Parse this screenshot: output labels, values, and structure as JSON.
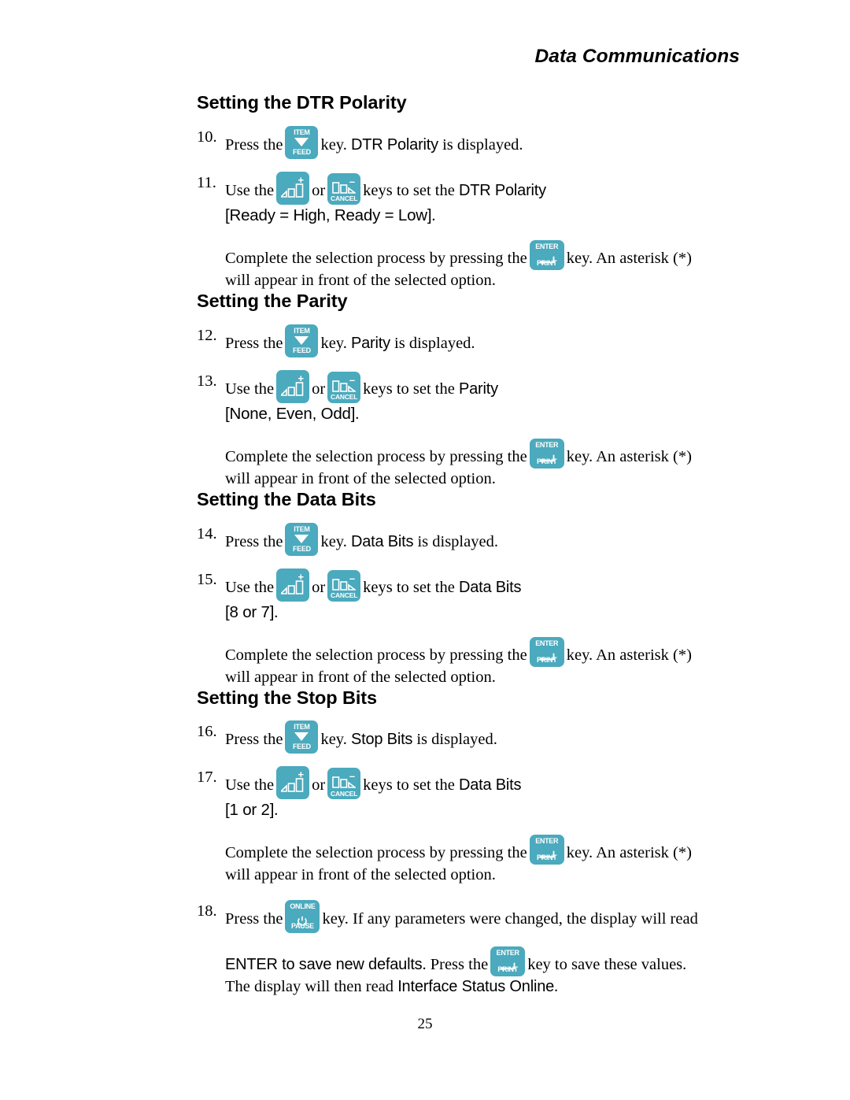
{
  "header": {
    "running_title": "Data Communications"
  },
  "footer": {
    "page_number": "25"
  },
  "keys": {
    "item_feed": {
      "top_label": "ITEM",
      "bottom_label": "FEED",
      "glyph": "triangle-down-icon"
    },
    "plus": {
      "sign": "+",
      "glyph": "bars-ascending-icon"
    },
    "cancel": {
      "sign": "–",
      "bottom_label": "CANCEL",
      "glyph": "bars-descending-icon"
    },
    "enter_print": {
      "top_label": "ENTER",
      "bottom_label": "PRINT",
      "glyph": "return-arrow-icon"
    },
    "online_pause": {
      "top_label": "ONLINE",
      "bottom_label": "PAUSE",
      "glyph": "power-icon"
    }
  },
  "colors": {
    "key_teal": "#4BAABD",
    "text": "#000000",
    "page_background": "#FFFFFF"
  },
  "sections": [
    {
      "title": "Setting the DTR Polarity",
      "steps": [
        {
          "number": "10.",
          "text_before_key": "Press the",
          "text_after_key": "key.",
          "display_value": "DTR Polarity",
          "text_tail": "is displayed."
        },
        {
          "number": "11.",
          "text_before_key": "Use the",
          "text_between_keys": "or",
          "text_after_keys": "keys to set the",
          "display_value": "DTR Polarity",
          "options": "[Ready = High, Ready = Low]",
          "options_period": "."
        }
      ],
      "completion": {
        "text_before_key": "Complete the selection process by pressing the",
        "text_after_key": "key. An asterisk (*)",
        "line2": "will appear in front of the selected option."
      }
    },
    {
      "title": "Setting the Parity",
      "steps": [
        {
          "number": "12.",
          "text_before_key": "Press the",
          "text_after_key": "key.",
          "display_value": "Parity",
          "text_tail": "is displayed."
        },
        {
          "number": "13.",
          "text_before_key": "Use the",
          "text_between_keys": "or",
          "text_after_keys": "keys to set the",
          "display_value": "Parity",
          "options": "[None, Even, Odd]",
          "options_period": "."
        }
      ],
      "completion": {
        "text_before_key": "Complete the selection process by pressing the",
        "text_after_key": "key. An asterisk (*)",
        "line2": "will appear in front of the selected option."
      }
    },
    {
      "title": "Setting the Data Bits",
      "steps": [
        {
          "number": "14.",
          "text_before_key": "Press the",
          "text_after_key": "key.",
          "display_value": "Data Bits",
          "text_tail": "is displayed."
        },
        {
          "number": "15.",
          "text_before_key": "Use the",
          "text_between_keys": "or",
          "text_after_keys": "keys to set the",
          "display_value": "Data Bits",
          "options": "[8 or 7]",
          "options_period": "."
        }
      ],
      "completion": {
        "text_before_key": "Complete the selection process by pressing the",
        "text_after_key": "key. An asterisk (*)",
        "line2": "will appear in front of the selected option."
      }
    },
    {
      "title": "Setting the Stop Bits",
      "steps": [
        {
          "number": "16.",
          "text_before_key": "Press the",
          "text_after_key": "key.",
          "display_value": "Stop Bits",
          "text_tail": "is displayed."
        },
        {
          "number": "17.",
          "text_before_key": "Use the",
          "text_between_keys": "or",
          "text_after_keys": "keys to set the",
          "display_value": "Data Bits",
          "options": "[1 or 2]",
          "options_period": "."
        }
      ],
      "completion": {
        "text_before_key": "Complete the selection process by pressing the",
        "text_after_key": "key. An asterisk (*)",
        "line2": "will appear in front of the selected option."
      }
    }
  ],
  "final_step": {
    "number": "18.",
    "text_before_key": "Press the",
    "text_after_key": "key. If any parameters were changed, the display will read",
    "display_message": "ENTER to save new defaults",
    "text_mid": ". Press the",
    "text_after_key2": "key to save these values.",
    "line3_before": "The display will then read",
    "display_message2": "Interface Status Online",
    "line3_period": "."
  }
}
